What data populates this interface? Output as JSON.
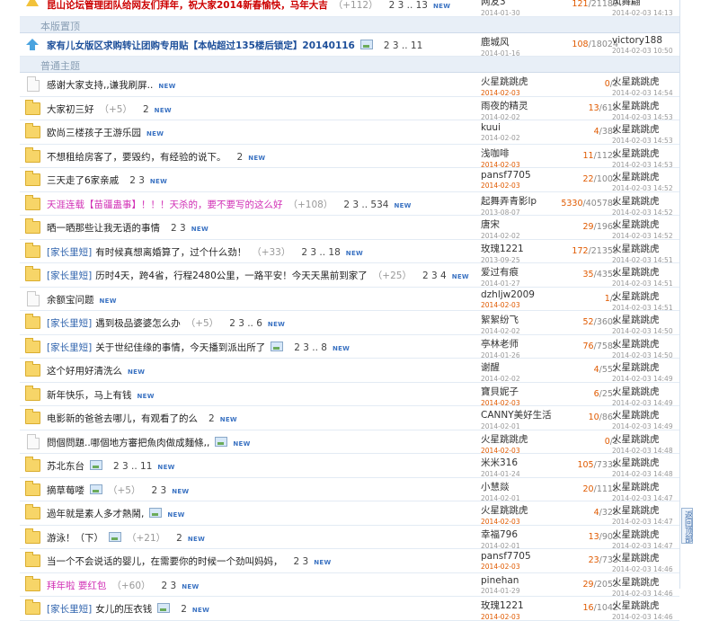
{
  "sections": {
    "pinned": "本版置顶",
    "normal": "普通主题"
  },
  "back_to_top": "返回顶部",
  "new_badge": "NEW",
  "top_rows": [
    {
      "icon": "warn",
      "style": "bold redt",
      "title": "昆山论坛管理团队给网友们拜年，祝大家2014新春愉快，马年大吉",
      "reply_hint": "（+112）",
      "pages": "2 3 .. 13",
      "new": true,
      "author": "网友3",
      "adate": "2014-01-30",
      "replies": "121",
      "views": "21189",
      "last": "风舞翩",
      "ldate": "2014-02-03 14:13"
    }
  ],
  "pinned_rows": [
    {
      "icon": "pin",
      "style": "bold",
      "title": "家有儿女版区求购转让团购专用贴【本帖超过135楼后锁定】20140116",
      "img": true,
      "pages": "2 3 .. 11",
      "author": "鹿城风",
      "adate": "2014-01-16",
      "replies": "108",
      "views": "18024",
      "last": "victory188",
      "ldate": "2014-02-03 10:50"
    }
  ],
  "rows": [
    {
      "icon": "doc",
      "title": "感谢大家支持,,谦我刷屏..",
      "new": true,
      "author": "火星跳跳虎",
      "adate": "2014-02-03",
      "hot": true,
      "replies": "0",
      "views": "1",
      "last": "火星跳跳虎",
      "ldate": "2014-02-03 14:54"
    },
    {
      "icon": "folder",
      "title": "大家初三好",
      "reply_hint": "（+5）",
      "pages": "2",
      "new": true,
      "author": "雨夜的精灵",
      "adate": "2014-02-02",
      "replies": "13",
      "views": "619",
      "last": "火星跳跳虎",
      "ldate": "2014-02-03 14:53"
    },
    {
      "icon": "folder",
      "title": "欧尚三楼孩子王游乐园",
      "new": true,
      "author": "kuui",
      "adate": "2014-02-02",
      "replies": "4",
      "views": "386",
      "last": "火星跳跳虎",
      "ldate": "2014-02-03 14:53"
    },
    {
      "icon": "folder",
      "title": "不想租给房客了，要毁约，有经验的说下。",
      "pages": "2",
      "new": true,
      "author": "浅咖啡",
      "adate": "2014-02-03",
      "hot": true,
      "replies": "11",
      "views": "1129",
      "last": "火星跳跳虎",
      "ldate": "2014-02-03 14:53"
    },
    {
      "icon": "folder",
      "title": "三天走了6家亲戚",
      "pages": "2 3",
      "new": true,
      "author": "pansf7705",
      "adate": "2014-02-03",
      "hot": true,
      "replies": "22",
      "views": "1003",
      "last": "火星跳跳虎",
      "ldate": "2014-02-03 14:52"
    },
    {
      "icon": "folder",
      "style": "pink",
      "title": "天涯连载【苗疆蛊事】！！！天杀的，要不要写的这么好",
      "reply_hint": "（+108）",
      "pages": "2 3 .. 534",
      "new": true,
      "author": "起舞弄青影lp",
      "adate": "2013-08-07",
      "replies": "5330",
      "views": "405786",
      "last": "火星跳跳虎",
      "ldate": "2014-02-03 14:52"
    },
    {
      "icon": "folder",
      "title": "晒一晒那些让我无语的事情",
      "pages": "2 3",
      "new": true,
      "author": "唐宋",
      "adate": "2014-02-02",
      "replies": "29",
      "views": "1969",
      "last": "火星跳跳虎",
      "ldate": "2014-02-03 14:52"
    },
    {
      "icon": "folder",
      "tag": "[家长里短]",
      "title": "有时候真想离婚算了，过个什么劲！",
      "reply_hint": "（+33）",
      "pages": "2 3 .. 18",
      "new": true,
      "author": "玫瑰1221",
      "adate": "2013-09-25",
      "replies": "172",
      "views": "21359",
      "last": "火星跳跳虎",
      "ldate": "2014-02-03 14:51"
    },
    {
      "icon": "folder",
      "tag": "[家长里短]",
      "title": "历时4天，跨4省，行程2480公里，一路平安！今天天黑前到家了",
      "reply_hint": "（+25）",
      "pages": "2 3 4",
      "new": true,
      "author": "爱过有痕",
      "adate": "2014-01-27",
      "replies": "35",
      "views": "4358",
      "last": "火星跳跳虎",
      "ldate": "2014-02-03 14:51"
    },
    {
      "icon": "doc",
      "title": "余额宝问题",
      "new": true,
      "author": "dzhljw2009",
      "adate": "2014-02-03",
      "hot": true,
      "replies": "1",
      "views": "2",
      "last": "火星跳跳虎",
      "ldate": "2014-02-03 14:51"
    },
    {
      "icon": "folder",
      "tag": "[家长里短]",
      "title": "遇到极品婆婆怎么办",
      "reply_hint": "（+5）",
      "pages": "2 3 .. 6",
      "new": true,
      "author": "絮絮纷飞",
      "adate": "2014-02-02",
      "replies": "52",
      "views": "3609",
      "last": "火星跳跳虎",
      "ldate": "2014-02-03 14:50"
    },
    {
      "icon": "folder",
      "tag": "[家长里短]",
      "title": "关于世纪佳缘的事情，今天播到派出所了",
      "img": true,
      "pages": "2 3 .. 8",
      "new": true,
      "author": "亭林老师",
      "adate": "2014-01-26",
      "replies": "76",
      "views": "7585",
      "last": "火星跳跳虎",
      "ldate": "2014-02-03 14:50"
    },
    {
      "icon": "folder",
      "title": "这个好用好清洗么",
      "new": true,
      "author": "谢醒",
      "adate": "2014-02-02",
      "replies": "4",
      "views": "557",
      "last": "火星跳跳虎",
      "ldate": "2014-02-03 14:49"
    },
    {
      "icon": "folder",
      "title": "新年快乐，马上有钱",
      "new": true,
      "author": "寶貝妮子",
      "adate": "2014-02-03",
      "hot": true,
      "replies": "6",
      "views": "257",
      "last": "火星跳跳虎",
      "ldate": "2014-02-03 14:49"
    },
    {
      "icon": "folder",
      "title": "电影新的爸爸去哪儿，有观看了的么",
      "pages": "2",
      "new": true,
      "author": "CANNY美好生活",
      "adate": "2014-02-01",
      "replies": "10",
      "views": "867",
      "last": "火星跳跳虎",
      "ldate": "2014-02-03 14:49"
    },
    {
      "icon": "doc",
      "title": "問個問題..哪個地方審把魚肉做成麵條,,",
      "img": true,
      "new": true,
      "author": "火星跳跳虎",
      "adate": "2014-02-03",
      "hot": true,
      "replies": "0",
      "views": "1",
      "last": "火星跳跳虎",
      "ldate": "2014-02-03 14:48"
    },
    {
      "icon": "folder",
      "title": "苏北东台",
      "img": true,
      "pages": "2 3 .. 11",
      "new": true,
      "author": "米米316",
      "adate": "2014-01-24",
      "replies": "105",
      "views": "7338",
      "last": "火星跳跳虎",
      "ldate": "2014-02-03 14:48"
    },
    {
      "icon": "folder",
      "title": "摘草莓喽",
      "img": true,
      "reply_hint": "（+5）",
      "pages": "2 3",
      "new": true,
      "author": "小慧燚",
      "adate": "2014-02-01",
      "replies": "20",
      "views": "1118",
      "last": "火星跳跳虎",
      "ldate": "2014-02-03 14:47"
    },
    {
      "icon": "folder",
      "title": "過年就是素人多才熱鬧,",
      "img": true,
      "new": true,
      "author": "火星跳跳虎",
      "adate": "2014-02-03",
      "hot": true,
      "replies": "4",
      "views": "328",
      "last": "火星跳跳虎",
      "ldate": "2014-02-03 14:47"
    },
    {
      "icon": "folder",
      "title": "游泳！（下）",
      "img": true,
      "reply_hint": "（+21）",
      "pages": "2",
      "new": true,
      "author": "幸福796",
      "adate": "2014-02-01",
      "replies": "13",
      "views": "903",
      "last": "火星跳跳虎",
      "ldate": "2014-02-03 14:47"
    },
    {
      "icon": "folder",
      "title": "当一个不会说话的婴儿，在需要你的时候一个劲叫妈妈，",
      "pages": "2 3",
      "new": true,
      "author": "pansf7705",
      "adate": "2014-02-03",
      "hot": true,
      "replies": "23",
      "views": "733",
      "last": "火星跳跳虎",
      "ldate": "2014-02-03 14:46"
    },
    {
      "icon": "folder",
      "style": "pink",
      "title": "拜年啦 要红包",
      "reply_hint": "（+60）",
      "pages": "2 3",
      "new": true,
      "author": "pinehan",
      "adate": "2014-01-29",
      "replies": "29",
      "views": "2053",
      "last": "火星跳跳虎",
      "ldate": "2014-02-03 14:46"
    },
    {
      "icon": "folder",
      "tag": "[家长里短]",
      "title": "女儿的压衣钱",
      "img": true,
      "pages": "2",
      "new": true,
      "author": "玫瑰1221",
      "adate": "2014-02-03",
      "hot": true,
      "replies": "16",
      "views": "1042",
      "last": "火星跳跳虎",
      "ldate": "2014-02-03 14:46"
    }
  ]
}
